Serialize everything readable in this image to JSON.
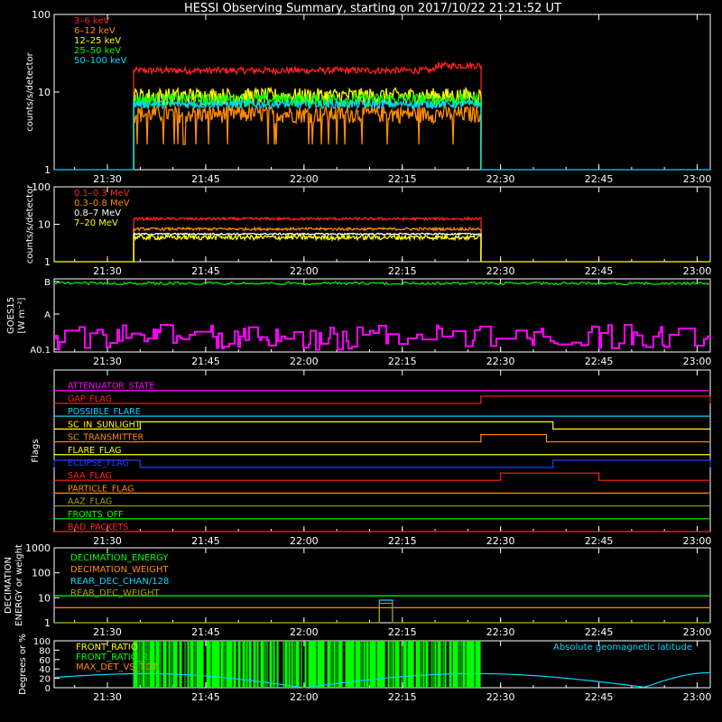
{
  "title": "HESSI Observing Summary, starting on 2017/10/22 21:21:52 UT",
  "colors": {
    "background": "#000000",
    "axis": "#ffffff",
    "red": "#ff2020",
    "orange": "#ff8c00",
    "yellow": "#ffff00",
    "green": "#00ff00",
    "cyan": "#00d8ff",
    "magenta": "#ff00ff",
    "blue": "#2040ff",
    "olive": "#a0a000"
  },
  "time_axis": {
    "ticks": [
      "21:30",
      "21:45",
      "22:00",
      "22:15",
      "22:30",
      "22:45",
      "23:00"
    ],
    "tick_minutes": [
      1290,
      1305,
      1320,
      1335,
      1350,
      1365,
      1380
    ],
    "range_minutes": [
      1281.87,
      1382.0
    ]
  },
  "chart_data": [
    {
      "id": "hxr",
      "type": "line",
      "ylabel": "counts/s/detector",
      "yscale": "log",
      "ylim": [
        1,
        100
      ],
      "ytick_labels": [
        "1",
        "10",
        "100"
      ],
      "active_interval": [
        "21:34",
        "22:27"
      ],
      "series": [
        {
          "name": "3–6 keV",
          "color": "#ff2020",
          "level": 19,
          "jitter": 0.1,
          "bump": 3
        },
        {
          "name": "6–12 keV",
          "color": "#ff8c00",
          "level": 5.3,
          "jitter": 0.25,
          "dips": 2.5
        },
        {
          "name": "12–25 keV",
          "color": "#ffff00",
          "level": 9,
          "jitter": 0.25
        },
        {
          "name": "25–50 keV",
          "color": "#00ff00",
          "level": 8,
          "jitter": 0.2
        },
        {
          "name": "50–100 keV",
          "color": "#00d8ff",
          "level": 7,
          "jitter": 0.12,
          "baseline": 1
        }
      ]
    },
    {
      "id": "gamma",
      "type": "line",
      "ylabel": "counts/s/detector",
      "yscale": "log",
      "ylim": [
        1,
        100
      ],
      "ytick_labels": [
        "1",
        "10",
        "100"
      ],
      "active_interval": [
        "21:34",
        "22:27"
      ],
      "series": [
        {
          "name": "0.1–0.3 MeV",
          "color": "#ff2020",
          "level": 14,
          "jitter": 0.08
        },
        {
          "name": "0.3–0.8 MeV",
          "color": "#ff8c00",
          "level": 7.5,
          "jitter": 0.08
        },
        {
          "name": "0.8–7 MeV",
          "color": "#ffffff",
          "level": 5.5,
          "jitter": 0.05
        },
        {
          "name": "7–20 MeV",
          "color": "#ffff00",
          "level": 4.5,
          "jitter": 0.15,
          "baseline": 1
        }
      ]
    },
    {
      "id": "goes",
      "type": "line",
      "ylabel": "GOES15",
      "ylabel2": "[W m⁻²]",
      "ytick_labels": [
        "A0.1",
        "A",
        "B"
      ],
      "series": [
        {
          "name": "GOES long",
          "color": "#00ff00",
          "level": "B"
        },
        {
          "name": "GOES short",
          "color": "#ff00ff",
          "level": "A0.1–A"
        }
      ]
    },
    {
      "id": "flags",
      "type": "state",
      "ylabel": "Flags",
      "flags": [
        {
          "label": "ATTENUATOR_STATE",
          "color": "#ff00ff",
          "high": []
        },
        {
          "label": "GAP_FLAG",
          "color": "#ff2020",
          "high": [
            [
              "22:27",
              "23:02"
            ]
          ]
        },
        {
          "label": "POSSIBLE_FLARE",
          "color": "#00d8ff",
          "high": []
        },
        {
          "label": "SC_IN_SUNLIGHT",
          "color": "#ffff00",
          "high": [
            [
              "21:35",
              "22:38"
            ]
          ]
        },
        {
          "label": "SC_TRANSMITTER",
          "color": "#ff8c00",
          "high": [
            [
              "22:27",
              "22:37"
            ]
          ]
        },
        {
          "label": "FLARE_FLAG",
          "color": "#ffff00",
          "high": []
        },
        {
          "label": "ECLIPSE_FLAG",
          "color": "#2040ff",
          "high": [
            [
              "21:21:52",
              "21:35"
            ],
            [
              "22:38",
              "23:02"
            ]
          ]
        },
        {
          "label": "SAA_FLAG",
          "color": "#ff2020",
          "high": [
            [
              "22:30",
              "22:45"
            ]
          ]
        },
        {
          "label": "PARTICLE_FLAG",
          "color": "#ff8c00",
          "high": []
        },
        {
          "label": "AAZ_FLAG",
          "color": "#a0a000",
          "high": []
        },
        {
          "label": "FRONTS_OFF",
          "color": "#00ff00",
          "high": []
        },
        {
          "label": "BAD_PACKETS",
          "color": "#ff2020",
          "high": []
        }
      ]
    },
    {
      "id": "decimation",
      "type": "line",
      "ylabel": "DECIMATION",
      "ylabel2": "ENERGY or weight",
      "yscale": "log",
      "ylim": [
        1,
        1000
      ],
      "ytick_labels": [
        "1",
        "10",
        "100",
        "1000"
      ],
      "series": [
        {
          "name": "DECIMATION_ENERGY",
          "color": "#00ff00",
          "value": 12
        },
        {
          "name": "DECIMATION_WEIGHT",
          "color": "#ff8c00",
          "value": 4
        },
        {
          "name": "REAR_DEC_CHAN/128",
          "color": "#00d8ff",
          "value": 1
        },
        {
          "name": "REAR_DEC_WEIGHT",
          "color": "#a0a000",
          "value": 1
        }
      ]
    },
    {
      "id": "ratio",
      "type": "line",
      "ylabel": "Degrees or %",
      "ylim": [
        0,
        100
      ],
      "ytick_labels": [
        "0",
        "20",
        "40",
        "60",
        "80",
        "100"
      ],
      "annotation": "Absolute geomagnetic latitude",
      "series": [
        {
          "name": "FRONT_RATIO",
          "color": "#ffff00"
        },
        {
          "name": "FRONT_RATIO_2",
          "color": "#00ff00",
          "active_interval": [
            "21:34",
            "22:27"
          ]
        },
        {
          "name": "MAX_DET_VS_TOT",
          "color": "#ff8c00"
        },
        {
          "name": "Absolute geomagnetic latitude",
          "color": "#00d8ff",
          "peaks": [
            30,
            30,
            32
          ],
          "troughs": [
            0,
            1
          ]
        }
      ]
    }
  ]
}
